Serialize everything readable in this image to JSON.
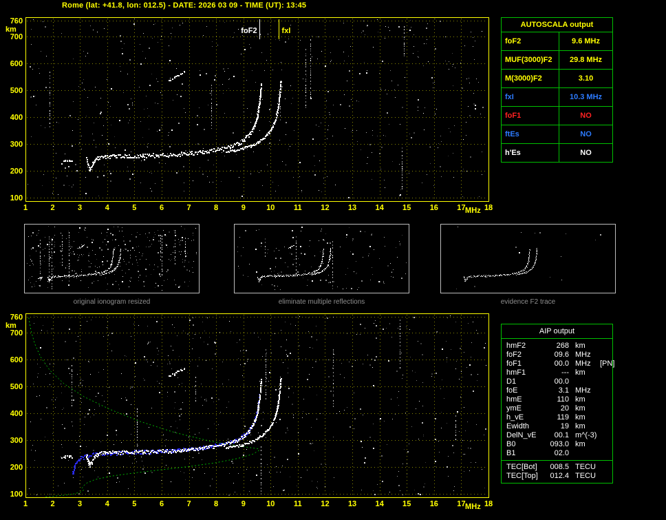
{
  "header": {
    "title": "Rome (lat: +41.8, lon: 012.5) - DATE: 2026 03 09 - TIME (UT): 13:45"
  },
  "autoscala_table": {
    "title": "AUTOSCALA output",
    "rows": [
      {
        "label": "foF2",
        "value": "9.6 MHz",
        "color": "#ffff00"
      },
      {
        "label": "MUF(3000)F2",
        "value": "29.8 MHz",
        "color": "#ffff00"
      },
      {
        "label": "M(3000)F2",
        "value": "3.10",
        "color": "#ffff00"
      },
      {
        "label": "fxI",
        "value": "10.3 MHz",
        "color": "#2d7bff"
      },
      {
        "label": "foF1",
        "value": "NO",
        "color": "#ff2222"
      },
      {
        "label": "ftEs",
        "value": "NO",
        "color": "#2d7bff"
      },
      {
        "label": "h'Es",
        "value": "NO",
        "color": "#ffffff"
      }
    ]
  },
  "aip_table": {
    "title": "AIP output",
    "rows": [
      {
        "label": "hmF2",
        "value": "268",
        "unit": "km",
        "extra": ""
      },
      {
        "label": "foF2",
        "value": "09.6",
        "unit": "MHz",
        "extra": ""
      },
      {
        "label": "foF1",
        "value": "00.0",
        "unit": "MHz",
        "extra": "[PN]"
      },
      {
        "label": "hmF1",
        "value": "---",
        "unit": "km",
        "extra": ""
      },
      {
        "label": "D1",
        "value": "00.0",
        "unit": "",
        "extra": ""
      },
      {
        "label": "foE",
        "value": "3.1",
        "unit": "MHz",
        "extra": ""
      },
      {
        "label": "hmE",
        "value": "110",
        "unit": "km",
        "extra": ""
      },
      {
        "label": "ymE",
        "value": "20",
        "unit": "km",
        "extra": ""
      },
      {
        "label": "h_vE",
        "value": "119",
        "unit": "km",
        "extra": ""
      },
      {
        "label": "Ewidth",
        "value": "19",
        "unit": "km",
        "extra": ""
      },
      {
        "label": "DelN_vE",
        "value": "00.1",
        "unit": "m^(-3)",
        "extra": ""
      },
      {
        "label": "B0",
        "value": "093.0",
        "unit": "km",
        "extra": ""
      },
      {
        "label": "B1",
        "value": "02.0",
        "unit": "",
        "extra": ""
      }
    ],
    "tec_rows": [
      {
        "label": "TEC[Bot]",
        "value": "008.5",
        "unit": "TECU",
        "extra": ""
      },
      {
        "label": "TEC[Top]",
        "value": "012.4",
        "unit": "TECU",
        "extra": ""
      }
    ]
  },
  "thumbnails": [
    {
      "caption": "original ionogram resized"
    },
    {
      "caption": "eliminate multiple reflections"
    },
    {
      "caption": "evidence F2 trace"
    }
  ],
  "chart_data": [
    {
      "id": "ionogram_top",
      "type": "scatter",
      "description": "reduced ionogram with autoscaled F2 trace",
      "xlabel": "MHz",
      "ylabel": "km",
      "xlim": [
        1,
        18
      ],
      "ylim": [
        87,
        773
      ],
      "xticks": [
        1,
        2,
        3,
        4,
        5,
        6,
        7,
        8,
        9,
        10,
        11,
        12,
        13,
        14,
        15,
        16,
        17,
        18
      ],
      "yticks": [
        100,
        200,
        300,
        400,
        500,
        600,
        700,
        760
      ],
      "grid": true,
      "axis_color": "#ffff00",
      "markers": [
        {
          "label": "foF2",
          "x": 9.6,
          "color": "#ffffff",
          "side": "left"
        },
        {
          "label": "fxI",
          "x": 10.3,
          "color": "#ffff00",
          "side": "right"
        }
      ],
      "noise": {
        "seed": 41,
        "count": 540,
        "streaks": 7,
        "color": "#ffffff"
      },
      "series": [
        {
          "name": "F2-O-trace",
          "color": "#ffffff",
          "width": 3,
          "points": [
            [
              3.22,
              248
            ],
            [
              3.28,
              226
            ],
            [
              3.34,
              208
            ],
            [
              3.42,
              220
            ],
            [
              3.52,
              238
            ],
            [
              3.66,
              250
            ],
            [
              3.9,
              254
            ],
            [
              4.3,
              256
            ],
            [
              4.8,
              257
            ],
            [
              5.3,
              258
            ],
            [
              5.8,
              259
            ],
            [
              6.3,
              261
            ],
            [
              6.7,
              264
            ],
            [
              7.1,
              268
            ],
            [
              7.5,
              272
            ],
            [
              7.9,
              278
            ],
            [
              8.2,
              284
            ],
            [
              8.5,
              292
            ],
            [
              8.8,
              303
            ],
            [
              9.0,
              316
            ],
            [
              9.18,
              333
            ],
            [
              9.32,
              354
            ],
            [
              9.42,
              378
            ],
            [
              9.5,
              405
            ],
            [
              9.55,
              435
            ],
            [
              9.59,
              468
            ],
            [
              9.62,
              500
            ],
            [
              9.64,
              528
            ]
          ]
        },
        {
          "name": "F2-X-trace",
          "color": "#ffffff",
          "width": 2,
          "points": [
            [
              8.35,
              272
            ],
            [
              8.65,
              277
            ],
            [
              8.95,
              284
            ],
            [
              9.25,
              294
            ],
            [
              9.5,
              306
            ],
            [
              9.72,
              321
            ],
            [
              9.9,
              340
            ],
            [
              10.05,
              364
            ],
            [
              10.17,
              393
            ],
            [
              10.25,
              428
            ],
            [
              10.3,
              465
            ],
            [
              10.34,
              505
            ],
            [
              10.36,
              535
            ]
          ]
        },
        {
          "name": "lead-in-echo",
          "color": "#ffffff",
          "width": 2,
          "step": 2.5,
          "points": [
            [
              2.32,
              234
            ],
            [
              2.45,
              240
            ],
            [
              2.58,
              242
            ],
            [
              2.68,
              239
            ]
          ]
        },
        {
          "name": "second-hop-fragment",
          "color": "#ffffff",
          "width": 2,
          "step": 3,
          "points": [
            [
              6.25,
              540
            ],
            [
              6.45,
              548
            ],
            [
              6.62,
              558
            ],
            [
              6.8,
              570
            ]
          ]
        }
      ]
    },
    {
      "id": "ionogram_bottom",
      "type": "scatter",
      "description": "ionogram with restored model trace and electron density profile",
      "xlabel": "MHz",
      "ylabel": "km",
      "xlim": [
        1,
        18
      ],
      "ylim": [
        87,
        773
      ],
      "xticks": [
        1,
        2,
        3,
        4,
        5,
        6,
        7,
        8,
        9,
        10,
        11,
        12,
        13,
        14,
        15,
        16,
        17,
        18
      ],
      "yticks": [
        100,
        200,
        300,
        400,
        500,
        600,
        700,
        760
      ],
      "grid": true,
      "axis_color": "#ffff00",
      "markers": [],
      "noise": {
        "seed": 97,
        "count": 620,
        "streaks": 8,
        "color": "#ffffff"
      },
      "series": [
        {
          "name": "electron-density-profile",
          "color": "#00b400",
          "width": 1,
          "draw": "line",
          "dash": [
            2,
            3
          ],
          "points": [
            [
              1.12,
              757
            ],
            [
              1.2,
              710
            ],
            [
              1.34,
              660
            ],
            [
              1.56,
              610
            ],
            [
              1.9,
              560
            ],
            [
              2.42,
              510
            ],
            [
              3.15,
              462
            ],
            [
              4.1,
              415
            ],
            [
              5.2,
              370
            ],
            [
              6.5,
              328
            ],
            [
              7.8,
              296
            ],
            [
              8.9,
              277
            ],
            [
              9.55,
              268
            ],
            [
              9.58,
              262
            ],
            [
              9.35,
              248
            ],
            [
              8.8,
              232
            ],
            [
              8.0,
              216
            ],
            [
              7.1,
              203
            ],
            [
              6.1,
              191
            ],
            [
              5.1,
              179
            ],
            [
              4.15,
              166
            ],
            [
              3.55,
              153
            ],
            [
              3.25,
              140
            ],
            [
              3.12,
              129
            ],
            [
              3.08,
              121
            ],
            [
              3.14,
              114
            ],
            [
              3.02,
              106
            ],
            [
              2.75,
              99
            ],
            [
              2.35,
              94
            ],
            [
              1.95,
              90
            ],
            [
              1.68,
              88
            ]
          ]
        },
        {
          "name": "model-trace",
          "color": "#2a2aee",
          "width": 3,
          "points": [
            [
              2.72,
              175
            ],
            [
              2.76,
              192
            ],
            [
              2.8,
              208
            ],
            [
              2.88,
              222
            ],
            [
              3.02,
              234
            ],
            [
              3.25,
              243
            ],
            [
              3.6,
              249
            ],
            [
              4.1,
              253
            ],
            [
              4.7,
              256
            ],
            [
              5.3,
              258
            ],
            [
              5.9,
              260
            ],
            [
              6.4,
              263
            ],
            [
              6.9,
              267
            ],
            [
              7.4,
              272
            ],
            [
              7.8,
              278
            ],
            [
              8.2,
              285
            ],
            [
              8.55,
              295
            ],
            [
              8.85,
              308
            ],
            [
              9.1,
              326
            ],
            [
              9.28,
              348
            ],
            [
              9.4,
              374
            ],
            [
              9.49,
              404
            ],
            [
              9.55,
              438
            ],
            [
              9.59,
              470
            ]
          ]
        },
        {
          "name": "F2-O-trace",
          "color": "#ffffff",
          "width": 3,
          "points": [
            [
              3.22,
              248
            ],
            [
              3.28,
              226
            ],
            [
              3.34,
              208
            ],
            [
              3.42,
              220
            ],
            [
              3.52,
              238
            ],
            [
              3.66,
              250
            ],
            [
              3.9,
              254
            ],
            [
              4.3,
              256
            ],
            [
              4.8,
              257
            ],
            [
              5.3,
              258
            ],
            [
              5.8,
              259
            ],
            [
              6.3,
              261
            ],
            [
              6.7,
              264
            ],
            [
              7.1,
              268
            ],
            [
              7.5,
              272
            ],
            [
              7.9,
              278
            ],
            [
              8.2,
              284
            ],
            [
              8.5,
              292
            ],
            [
              8.8,
              303
            ],
            [
              9.0,
              316
            ],
            [
              9.18,
              333
            ],
            [
              9.32,
              354
            ],
            [
              9.42,
              378
            ],
            [
              9.5,
              405
            ],
            [
              9.55,
              435
            ],
            [
              9.59,
              468
            ],
            [
              9.62,
              500
            ],
            [
              9.64,
              528
            ]
          ]
        },
        {
          "name": "F2-X-trace",
          "color": "#ffffff",
          "width": 2,
          "points": [
            [
              8.35,
              272
            ],
            [
              8.65,
              277
            ],
            [
              8.95,
              284
            ],
            [
              9.25,
              294
            ],
            [
              9.5,
              306
            ],
            [
              9.72,
              321
            ],
            [
              9.9,
              340
            ],
            [
              10.05,
              364
            ],
            [
              10.17,
              393
            ],
            [
              10.25,
              428
            ],
            [
              10.3,
              465
            ],
            [
              10.34,
              505
            ],
            [
              10.36,
              535
            ]
          ]
        },
        {
          "name": "lead-in-echo",
          "color": "#ffffff",
          "width": 2,
          "step": 2.5,
          "points": [
            [
              2.32,
              234
            ],
            [
              2.45,
              240
            ],
            [
              2.58,
              242
            ],
            [
              2.68,
              239
            ]
          ]
        },
        {
          "name": "second-hop-fragment",
          "color": "#ffffff",
          "width": 2,
          "step": 3,
          "points": [
            [
              6.25,
              540
            ],
            [
              6.45,
              548
            ],
            [
              6.62,
              558
            ],
            [
              6.8,
              570
            ]
          ]
        }
      ]
    }
  ]
}
